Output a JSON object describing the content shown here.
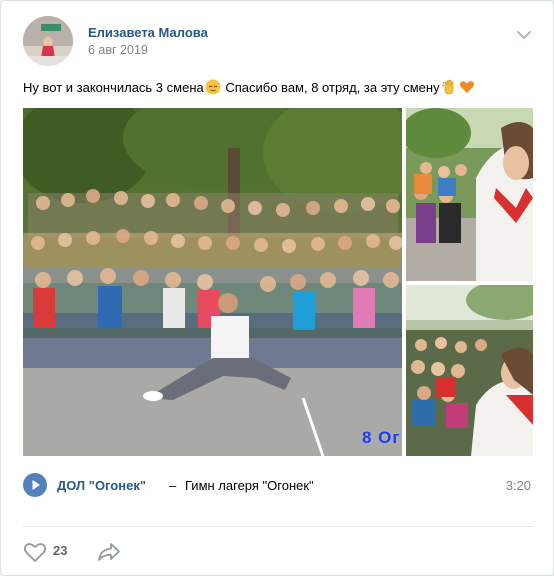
{
  "post": {
    "author": "Елизавета Малова",
    "date": "6 авг 2019",
    "text_part1": "Ну вот и закончилась 3 смена",
    "text_part2": " Спасибо вам, 8 отряд, за эту смену",
    "emoji_1": "relieved-face-emoji",
    "emoji_2": "waving-hand-emoji",
    "emoji_3": "orange-heart-emoji"
  },
  "photos": {
    "main_watermark": "8 Ог"
  },
  "audio": {
    "artist": "ДОЛ \"Огонек\"",
    "separator": "–",
    "title": "Гимн лагеря \"Огонек\"",
    "duration": "3:20"
  },
  "actions": {
    "like_count": "23"
  },
  "colors": {
    "link": "#2a5885",
    "accent": "#5181b8",
    "muted": "#828282"
  }
}
